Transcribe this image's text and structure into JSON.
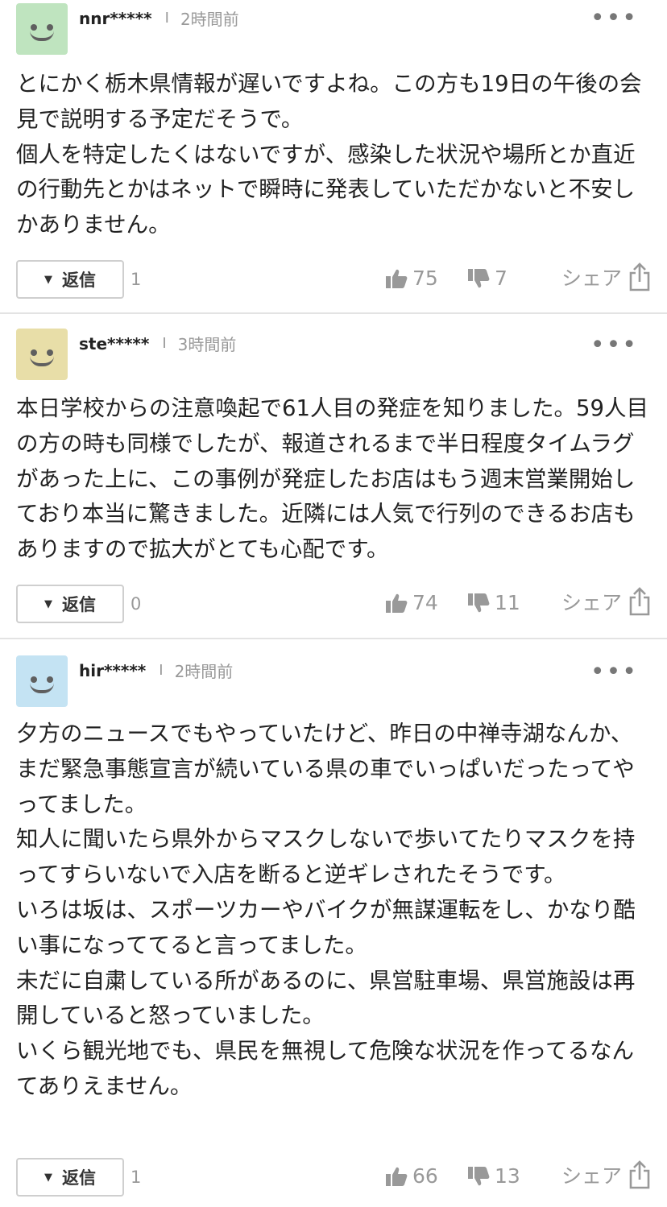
{
  "colors": {
    "avatar_green": "#bfe4bf",
    "avatar_yellow": "#e8dea8",
    "avatar_blue": "#c4e3f3"
  },
  "comments": [
    {
      "username": "nnr*****",
      "separator": "I",
      "time": "2時間前",
      "more_label": "•••",
      "text": "とにかく栃木県情報が遅いですよね。この方も19日の午後の会見で説明する予定だそうで。\n個人を特定したくはないですが、感染した状況や場所とか直近の行動先とかはネットで瞬時に発表していただかないと不安しかありません。",
      "reply_label": "返信",
      "reply_arrow": "▼",
      "reply_count": "1",
      "likes": "75",
      "dislikes": "7",
      "share_label": "シェア",
      "avatar_icon": "smiley-face-icon"
    },
    {
      "username": "ste*****",
      "separator": "I",
      "time": "3時間前",
      "more_label": "•••",
      "text": "本日学校からの注意喚起で61人目の発症を知りました。59人目の方の時も同様でしたが、報道されるまで半日程度タイムラグがあった上に、この事例が発症したお店はもう週末営業開始しており本当に驚きました。近隣には人気で行列のできるお店もありますので拡大がとても心配です。",
      "reply_label": "返信",
      "reply_arrow": "▼",
      "reply_count": "0",
      "likes": "74",
      "dislikes": "11",
      "share_label": "シェア",
      "avatar_icon": "smiley-face-icon"
    },
    {
      "username": "hir*****",
      "separator": "I",
      "time": "2時間前",
      "more_label": "•••",
      "text": "夕方のニュースでもやっていたけど、昨日の中禅寺湖なんか、まだ緊急事態宣言が続いている県の車でいっぱいだったってやってました。\n知人に聞いたら県外からマスクしないで歩いてたりマスクを持ってすらいないで入店を断ると逆ギレされたそうです。\nいろは坂は、スポーツカーやバイクが無謀運転をし、かなり酷い事になっててると言ってました。\n未だに自粛している所があるのに、県営駐車場、県営施設は再開していると怒っていました。\nいくら観光地でも、県民を無視して危険な状況を作ってるなんてありえません。",
      "reply_label": "返信",
      "reply_arrow": "▼",
      "reply_count": "1",
      "likes": "66",
      "dislikes": "13",
      "share_label": "シェア",
      "avatar_icon": "smiley-face-icon"
    }
  ]
}
